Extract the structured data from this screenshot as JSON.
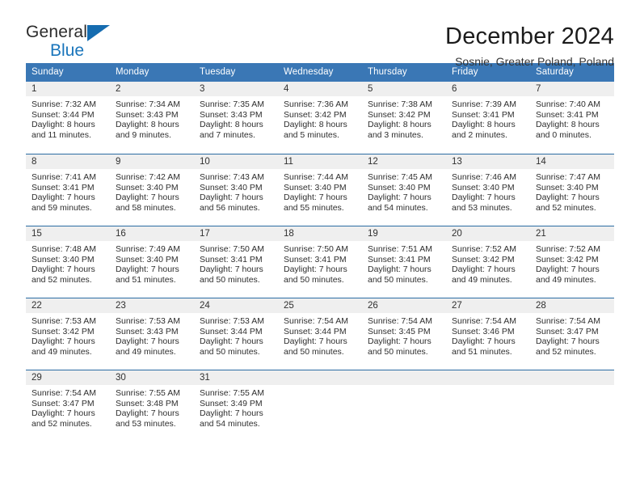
{
  "brand": {
    "name_part1": "General",
    "name_part2": "Blue",
    "triangle_color": "#156cb0",
    "blue_color": "#1a75bb"
  },
  "header": {
    "title": "December 2024",
    "subtitle": "Sosnie, Greater Poland, Poland"
  },
  "theme": {
    "header_row_bg": "#3a77b5",
    "daynum_bg": "#efefef",
    "week_separator": "#2b6ca3"
  },
  "weekdays": [
    "Sunday",
    "Monday",
    "Tuesday",
    "Wednesday",
    "Thursday",
    "Friday",
    "Saturday"
  ],
  "weeks": [
    [
      {
        "day": "1",
        "sunrise": "Sunrise: 7:32 AM",
        "sunset": "Sunset: 3:44 PM",
        "daylight1": "Daylight: 8 hours",
        "daylight2": "and 11 minutes."
      },
      {
        "day": "2",
        "sunrise": "Sunrise: 7:34 AM",
        "sunset": "Sunset: 3:43 PM",
        "daylight1": "Daylight: 8 hours",
        "daylight2": "and 9 minutes."
      },
      {
        "day": "3",
        "sunrise": "Sunrise: 7:35 AM",
        "sunset": "Sunset: 3:43 PM",
        "daylight1": "Daylight: 8 hours",
        "daylight2": "and 7 minutes."
      },
      {
        "day": "4",
        "sunrise": "Sunrise: 7:36 AM",
        "sunset": "Sunset: 3:42 PM",
        "daylight1": "Daylight: 8 hours",
        "daylight2": "and 5 minutes."
      },
      {
        "day": "5",
        "sunrise": "Sunrise: 7:38 AM",
        "sunset": "Sunset: 3:42 PM",
        "daylight1": "Daylight: 8 hours",
        "daylight2": "and 3 minutes."
      },
      {
        "day": "6",
        "sunrise": "Sunrise: 7:39 AM",
        "sunset": "Sunset: 3:41 PM",
        "daylight1": "Daylight: 8 hours",
        "daylight2": "and 2 minutes."
      },
      {
        "day": "7",
        "sunrise": "Sunrise: 7:40 AM",
        "sunset": "Sunset: 3:41 PM",
        "daylight1": "Daylight: 8 hours",
        "daylight2": "and 0 minutes."
      }
    ],
    [
      {
        "day": "8",
        "sunrise": "Sunrise: 7:41 AM",
        "sunset": "Sunset: 3:41 PM",
        "daylight1": "Daylight: 7 hours",
        "daylight2": "and 59 minutes."
      },
      {
        "day": "9",
        "sunrise": "Sunrise: 7:42 AM",
        "sunset": "Sunset: 3:40 PM",
        "daylight1": "Daylight: 7 hours",
        "daylight2": "and 58 minutes."
      },
      {
        "day": "10",
        "sunrise": "Sunrise: 7:43 AM",
        "sunset": "Sunset: 3:40 PM",
        "daylight1": "Daylight: 7 hours",
        "daylight2": "and 56 minutes."
      },
      {
        "day": "11",
        "sunrise": "Sunrise: 7:44 AM",
        "sunset": "Sunset: 3:40 PM",
        "daylight1": "Daylight: 7 hours",
        "daylight2": "and 55 minutes."
      },
      {
        "day": "12",
        "sunrise": "Sunrise: 7:45 AM",
        "sunset": "Sunset: 3:40 PM",
        "daylight1": "Daylight: 7 hours",
        "daylight2": "and 54 minutes."
      },
      {
        "day": "13",
        "sunrise": "Sunrise: 7:46 AM",
        "sunset": "Sunset: 3:40 PM",
        "daylight1": "Daylight: 7 hours",
        "daylight2": "and 53 minutes."
      },
      {
        "day": "14",
        "sunrise": "Sunrise: 7:47 AM",
        "sunset": "Sunset: 3:40 PM",
        "daylight1": "Daylight: 7 hours",
        "daylight2": "and 52 minutes."
      }
    ],
    [
      {
        "day": "15",
        "sunrise": "Sunrise: 7:48 AM",
        "sunset": "Sunset: 3:40 PM",
        "daylight1": "Daylight: 7 hours",
        "daylight2": "and 52 minutes."
      },
      {
        "day": "16",
        "sunrise": "Sunrise: 7:49 AM",
        "sunset": "Sunset: 3:40 PM",
        "daylight1": "Daylight: 7 hours",
        "daylight2": "and 51 minutes."
      },
      {
        "day": "17",
        "sunrise": "Sunrise: 7:50 AM",
        "sunset": "Sunset: 3:41 PM",
        "daylight1": "Daylight: 7 hours",
        "daylight2": "and 50 minutes."
      },
      {
        "day": "18",
        "sunrise": "Sunrise: 7:50 AM",
        "sunset": "Sunset: 3:41 PM",
        "daylight1": "Daylight: 7 hours",
        "daylight2": "and 50 minutes."
      },
      {
        "day": "19",
        "sunrise": "Sunrise: 7:51 AM",
        "sunset": "Sunset: 3:41 PM",
        "daylight1": "Daylight: 7 hours",
        "daylight2": "and 50 minutes."
      },
      {
        "day": "20",
        "sunrise": "Sunrise: 7:52 AM",
        "sunset": "Sunset: 3:42 PM",
        "daylight1": "Daylight: 7 hours",
        "daylight2": "and 49 minutes."
      },
      {
        "day": "21",
        "sunrise": "Sunrise: 7:52 AM",
        "sunset": "Sunset: 3:42 PM",
        "daylight1": "Daylight: 7 hours",
        "daylight2": "and 49 minutes."
      }
    ],
    [
      {
        "day": "22",
        "sunrise": "Sunrise: 7:53 AM",
        "sunset": "Sunset: 3:42 PM",
        "daylight1": "Daylight: 7 hours",
        "daylight2": "and 49 minutes."
      },
      {
        "day": "23",
        "sunrise": "Sunrise: 7:53 AM",
        "sunset": "Sunset: 3:43 PM",
        "daylight1": "Daylight: 7 hours",
        "daylight2": "and 49 minutes."
      },
      {
        "day": "24",
        "sunrise": "Sunrise: 7:53 AM",
        "sunset": "Sunset: 3:44 PM",
        "daylight1": "Daylight: 7 hours",
        "daylight2": "and 50 minutes."
      },
      {
        "day": "25",
        "sunrise": "Sunrise: 7:54 AM",
        "sunset": "Sunset: 3:44 PM",
        "daylight1": "Daylight: 7 hours",
        "daylight2": "and 50 minutes."
      },
      {
        "day": "26",
        "sunrise": "Sunrise: 7:54 AM",
        "sunset": "Sunset: 3:45 PM",
        "daylight1": "Daylight: 7 hours",
        "daylight2": "and 50 minutes."
      },
      {
        "day": "27",
        "sunrise": "Sunrise: 7:54 AM",
        "sunset": "Sunset: 3:46 PM",
        "daylight1": "Daylight: 7 hours",
        "daylight2": "and 51 minutes."
      },
      {
        "day": "28",
        "sunrise": "Sunrise: 7:54 AM",
        "sunset": "Sunset: 3:47 PM",
        "daylight1": "Daylight: 7 hours",
        "daylight2": "and 52 minutes."
      }
    ],
    [
      {
        "day": "29",
        "sunrise": "Sunrise: 7:54 AM",
        "sunset": "Sunset: 3:47 PM",
        "daylight1": "Daylight: 7 hours",
        "daylight2": "and 52 minutes."
      },
      {
        "day": "30",
        "sunrise": "Sunrise: 7:55 AM",
        "sunset": "Sunset: 3:48 PM",
        "daylight1": "Daylight: 7 hours",
        "daylight2": "and 53 minutes."
      },
      {
        "day": "31",
        "sunrise": "Sunrise: 7:55 AM",
        "sunset": "Sunset: 3:49 PM",
        "daylight1": "Daylight: 7 hours",
        "daylight2": "and 54 minutes."
      },
      {
        "day": "",
        "sunrise": "",
        "sunset": "",
        "daylight1": "",
        "daylight2": ""
      },
      {
        "day": "",
        "sunrise": "",
        "sunset": "",
        "daylight1": "",
        "daylight2": ""
      },
      {
        "day": "",
        "sunrise": "",
        "sunset": "",
        "daylight1": "",
        "daylight2": ""
      },
      {
        "day": "",
        "sunrise": "",
        "sunset": "",
        "daylight1": "",
        "daylight2": ""
      }
    ]
  ]
}
